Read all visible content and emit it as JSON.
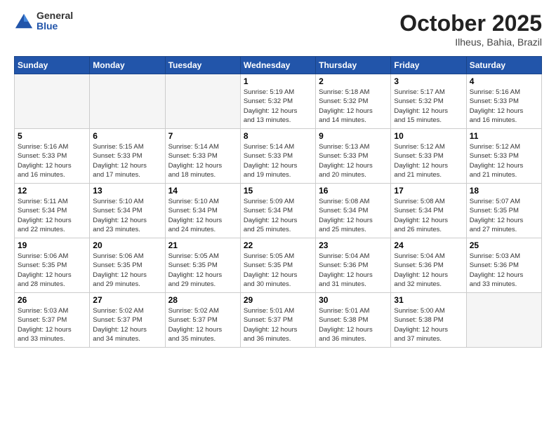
{
  "header": {
    "logo_general": "General",
    "logo_blue": "Blue",
    "month": "October 2025",
    "location": "Ilheus, Bahia, Brazil"
  },
  "weekdays": [
    "Sunday",
    "Monday",
    "Tuesday",
    "Wednesday",
    "Thursday",
    "Friday",
    "Saturday"
  ],
  "weeks": [
    [
      {
        "day": "",
        "info": ""
      },
      {
        "day": "",
        "info": ""
      },
      {
        "day": "",
        "info": ""
      },
      {
        "day": "1",
        "info": "Sunrise: 5:19 AM\nSunset: 5:32 PM\nDaylight: 12 hours\nand 13 minutes."
      },
      {
        "day": "2",
        "info": "Sunrise: 5:18 AM\nSunset: 5:32 PM\nDaylight: 12 hours\nand 14 minutes."
      },
      {
        "day": "3",
        "info": "Sunrise: 5:17 AM\nSunset: 5:32 PM\nDaylight: 12 hours\nand 15 minutes."
      },
      {
        "day": "4",
        "info": "Sunrise: 5:16 AM\nSunset: 5:33 PM\nDaylight: 12 hours\nand 16 minutes."
      }
    ],
    [
      {
        "day": "5",
        "info": "Sunrise: 5:16 AM\nSunset: 5:33 PM\nDaylight: 12 hours\nand 16 minutes."
      },
      {
        "day": "6",
        "info": "Sunrise: 5:15 AM\nSunset: 5:33 PM\nDaylight: 12 hours\nand 17 minutes."
      },
      {
        "day": "7",
        "info": "Sunrise: 5:14 AM\nSunset: 5:33 PM\nDaylight: 12 hours\nand 18 minutes."
      },
      {
        "day": "8",
        "info": "Sunrise: 5:14 AM\nSunset: 5:33 PM\nDaylight: 12 hours\nand 19 minutes."
      },
      {
        "day": "9",
        "info": "Sunrise: 5:13 AM\nSunset: 5:33 PM\nDaylight: 12 hours\nand 20 minutes."
      },
      {
        "day": "10",
        "info": "Sunrise: 5:12 AM\nSunset: 5:33 PM\nDaylight: 12 hours\nand 21 minutes."
      },
      {
        "day": "11",
        "info": "Sunrise: 5:12 AM\nSunset: 5:33 PM\nDaylight: 12 hours\nand 21 minutes."
      }
    ],
    [
      {
        "day": "12",
        "info": "Sunrise: 5:11 AM\nSunset: 5:34 PM\nDaylight: 12 hours\nand 22 minutes."
      },
      {
        "day": "13",
        "info": "Sunrise: 5:10 AM\nSunset: 5:34 PM\nDaylight: 12 hours\nand 23 minutes."
      },
      {
        "day": "14",
        "info": "Sunrise: 5:10 AM\nSunset: 5:34 PM\nDaylight: 12 hours\nand 24 minutes."
      },
      {
        "day": "15",
        "info": "Sunrise: 5:09 AM\nSunset: 5:34 PM\nDaylight: 12 hours\nand 25 minutes."
      },
      {
        "day": "16",
        "info": "Sunrise: 5:08 AM\nSunset: 5:34 PM\nDaylight: 12 hours\nand 25 minutes."
      },
      {
        "day": "17",
        "info": "Sunrise: 5:08 AM\nSunset: 5:34 PM\nDaylight: 12 hours\nand 26 minutes."
      },
      {
        "day": "18",
        "info": "Sunrise: 5:07 AM\nSunset: 5:35 PM\nDaylight: 12 hours\nand 27 minutes."
      }
    ],
    [
      {
        "day": "19",
        "info": "Sunrise: 5:06 AM\nSunset: 5:35 PM\nDaylight: 12 hours\nand 28 minutes."
      },
      {
        "day": "20",
        "info": "Sunrise: 5:06 AM\nSunset: 5:35 PM\nDaylight: 12 hours\nand 29 minutes."
      },
      {
        "day": "21",
        "info": "Sunrise: 5:05 AM\nSunset: 5:35 PM\nDaylight: 12 hours\nand 29 minutes."
      },
      {
        "day": "22",
        "info": "Sunrise: 5:05 AM\nSunset: 5:35 PM\nDaylight: 12 hours\nand 30 minutes."
      },
      {
        "day": "23",
        "info": "Sunrise: 5:04 AM\nSunset: 5:36 PM\nDaylight: 12 hours\nand 31 minutes."
      },
      {
        "day": "24",
        "info": "Sunrise: 5:04 AM\nSunset: 5:36 PM\nDaylight: 12 hours\nand 32 minutes."
      },
      {
        "day": "25",
        "info": "Sunrise: 5:03 AM\nSunset: 5:36 PM\nDaylight: 12 hours\nand 33 minutes."
      }
    ],
    [
      {
        "day": "26",
        "info": "Sunrise: 5:03 AM\nSunset: 5:37 PM\nDaylight: 12 hours\nand 33 minutes."
      },
      {
        "day": "27",
        "info": "Sunrise: 5:02 AM\nSunset: 5:37 PM\nDaylight: 12 hours\nand 34 minutes."
      },
      {
        "day": "28",
        "info": "Sunrise: 5:02 AM\nSunset: 5:37 PM\nDaylight: 12 hours\nand 35 minutes."
      },
      {
        "day": "29",
        "info": "Sunrise: 5:01 AM\nSunset: 5:37 PM\nDaylight: 12 hours\nand 36 minutes."
      },
      {
        "day": "30",
        "info": "Sunrise: 5:01 AM\nSunset: 5:38 PM\nDaylight: 12 hours\nand 36 minutes."
      },
      {
        "day": "31",
        "info": "Sunrise: 5:00 AM\nSunset: 5:38 PM\nDaylight: 12 hours\nand 37 minutes."
      },
      {
        "day": "",
        "info": ""
      }
    ]
  ]
}
